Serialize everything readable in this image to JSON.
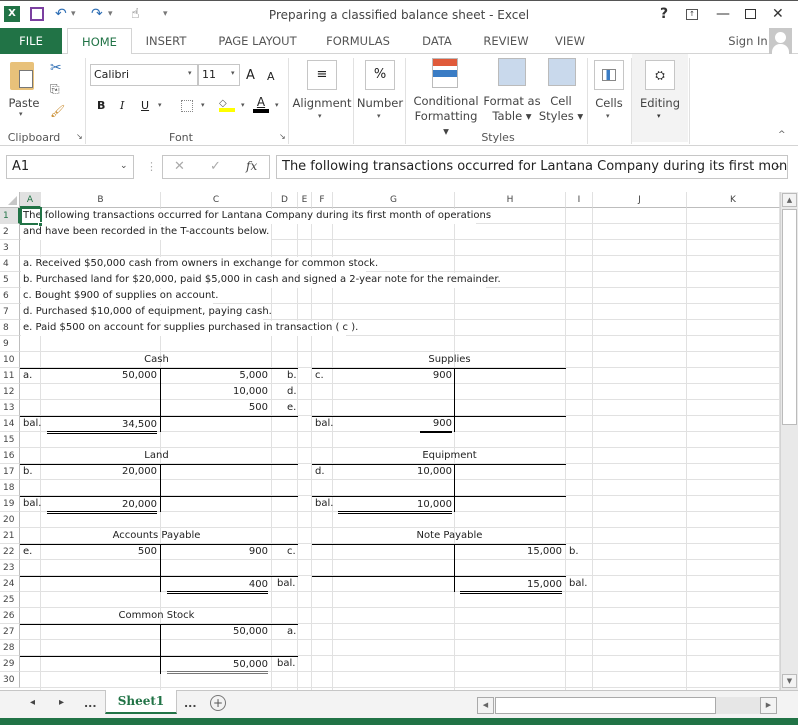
{
  "window": {
    "title": "Preparing a classified balance sheet - Excel",
    "help": "?",
    "minimize": "—",
    "restore": "🗗",
    "close": "✕"
  },
  "quick_access": {
    "excel_logo": "X",
    "save": "💾",
    "undo": "↶",
    "redo": "↷",
    "touch": "☝",
    "customize": "▾"
  },
  "tabs": [
    "FILE",
    "HOME",
    "INSERT",
    "PAGE LAYOUT",
    "FORMULAS",
    "DATA",
    "REVIEW",
    "VIEW"
  ],
  "active_tab": "HOME",
  "sign_in": "Sign In",
  "ribbon": {
    "clipboard": {
      "paste": "Paste",
      "label": "Clipboard"
    },
    "font": {
      "name": "Calibri",
      "size": "11",
      "bold": "B",
      "italic": "I",
      "underline": "U",
      "grow": "A",
      "shrink": "A",
      "font_color": "A",
      "label": "Font"
    },
    "alignment": {
      "label": "Alignment"
    },
    "number": {
      "label": "Number",
      "symbol": "%"
    },
    "styles": {
      "conditional_line1": "Conditional",
      "conditional_line2": "Formatting ▾",
      "format_table_line1": "Format as",
      "format_table_line2": "Table ▾",
      "cell_styles_line1": "Cell",
      "cell_styles_line2": "Styles ▾",
      "label": "Styles"
    },
    "cells": {
      "label": "Cells"
    },
    "editing": {
      "label": "Editing"
    }
  },
  "formula_bar": {
    "name_box": "A1",
    "cancel": "✕",
    "enter": "✓",
    "fx": "fx",
    "content": "The following transactions occurred for Lantana Company during its first month"
  },
  "columns": [
    "A",
    "B",
    "C",
    "D",
    "E",
    "F",
    "G",
    "H",
    "I",
    "J",
    "K"
  ],
  "rows": [
    "1",
    "2",
    "3",
    "4",
    "5",
    "6",
    "7",
    "8",
    "9",
    "10",
    "11",
    "12",
    "13",
    "14",
    "15",
    "16",
    "17",
    "18",
    "19",
    "20",
    "21",
    "22",
    "23",
    "24",
    "25",
    "26",
    "27",
    "28",
    "29",
    "30"
  ],
  "sheet": {
    "intro1": "The following transactions occurred for Lantana Company during its first month of operations",
    "intro2": "and have been recorded in the T-accounts below.",
    "t_a": "a. Received $50,000 cash from owners in exchange for common stock.",
    "t_b": "b. Purchased land for $20,000, paid $5,000 in cash and signed a 2-year note for the remainder.",
    "t_c": "c. Bought $900 of supplies on account.",
    "t_d": "d. Purchased $10,000 of equipment, paying cash.",
    "t_e": "e. Paid $500 on account for supplies purchased in transaction ( c ).",
    "cash": {
      "title": "Cash",
      "debit_label": "a.",
      "debit": "50,000",
      "credits": [
        {
          "amount": "5,000",
          "ref": "b."
        },
        {
          "amount": "10,000",
          "ref": "d."
        },
        {
          "amount": "500",
          "ref": "e."
        }
      ],
      "bal_label": "bal.",
      "balance": "34,500"
    },
    "supplies": {
      "title": "Supplies",
      "debit_label": "c.",
      "debit": "900",
      "bal_label": "bal.",
      "balance": "900"
    },
    "land": {
      "title": "Land",
      "debit_label": "b.",
      "debit": "20,000",
      "bal_label": "bal.",
      "balance": "20,000"
    },
    "equipment": {
      "title": "Equipment",
      "debit_label": "d.",
      "debit": "10,000",
      "bal_label": "bal.",
      "balance": "10,000"
    },
    "accounts_payable": {
      "title": "Accounts Payable",
      "debit_label": "e.",
      "debit": "500",
      "credit": "900",
      "credit_ref": "c.",
      "balance": "400",
      "bal_label": "bal."
    },
    "note_payable": {
      "title": "Note Payable",
      "credit": "15,000",
      "credit_ref": "b.",
      "balance": "15,000",
      "bal_label": "bal."
    },
    "common_stock": {
      "title": "Common Stock",
      "credit": "50,000",
      "credit_ref": "a.",
      "balance": "50,000",
      "bal_label": "bal."
    }
  },
  "sheet_tabs": {
    "prev": "◂",
    "next": "▸",
    "more_left": "...",
    "active": "Sheet1",
    "more_right": "...",
    "add": "+"
  },
  "colors": {
    "excel_green": "#217346"
  }
}
